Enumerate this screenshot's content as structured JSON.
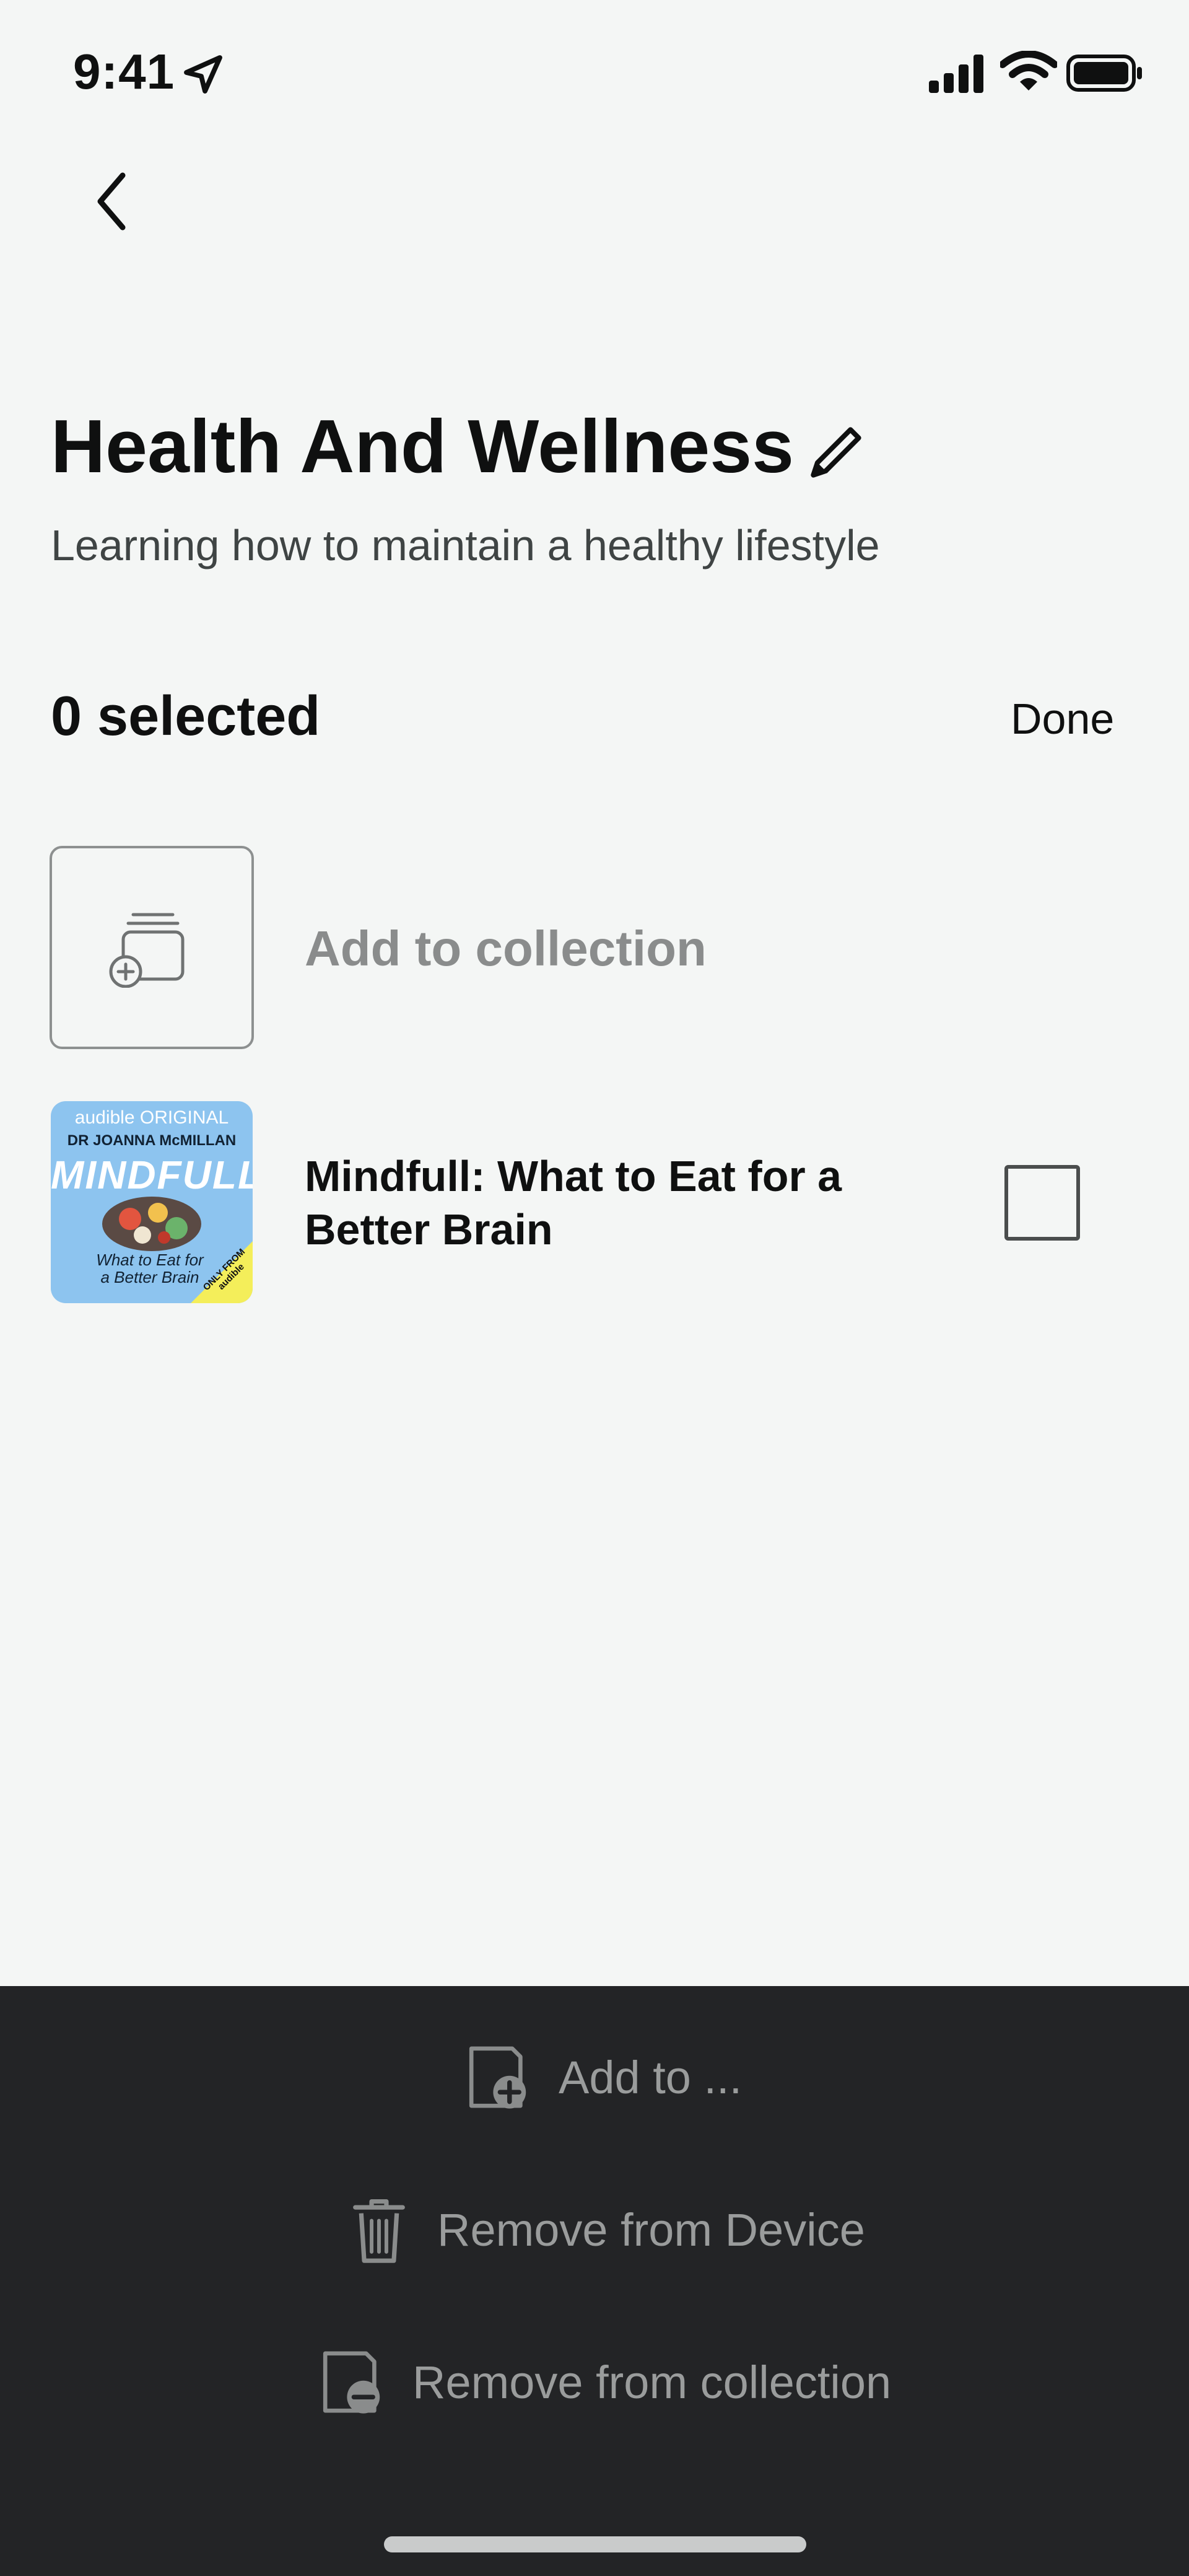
{
  "status_bar": {
    "time": "9:41"
  },
  "header": {
    "title": "Health And Wellness",
    "subtitle": "Learning how to maintain a healthy lifestyle"
  },
  "selection": {
    "count_label": "0 selected",
    "done_label": "Done"
  },
  "add_to_collection": {
    "label": "Add to collection"
  },
  "books": [
    {
      "title": "Mindfull: What to Eat for a Better Brain",
      "cover": {
        "brand": "audible ORIGINAL",
        "author": "DR JOANNA McMILLAN",
        "title": "MINDFULL",
        "subtitle": "What to Eat for a Better Brain",
        "badge": "ONLY FROM audible"
      },
      "selected": false
    }
  ],
  "actions": {
    "add_to": "Add to ...",
    "remove_device": "Remove from Device",
    "remove_collection": "Remove from collection"
  },
  "colors": {
    "background": "#f4f6f5",
    "sheet": "#232426",
    "cover": "#8dc4ef"
  }
}
